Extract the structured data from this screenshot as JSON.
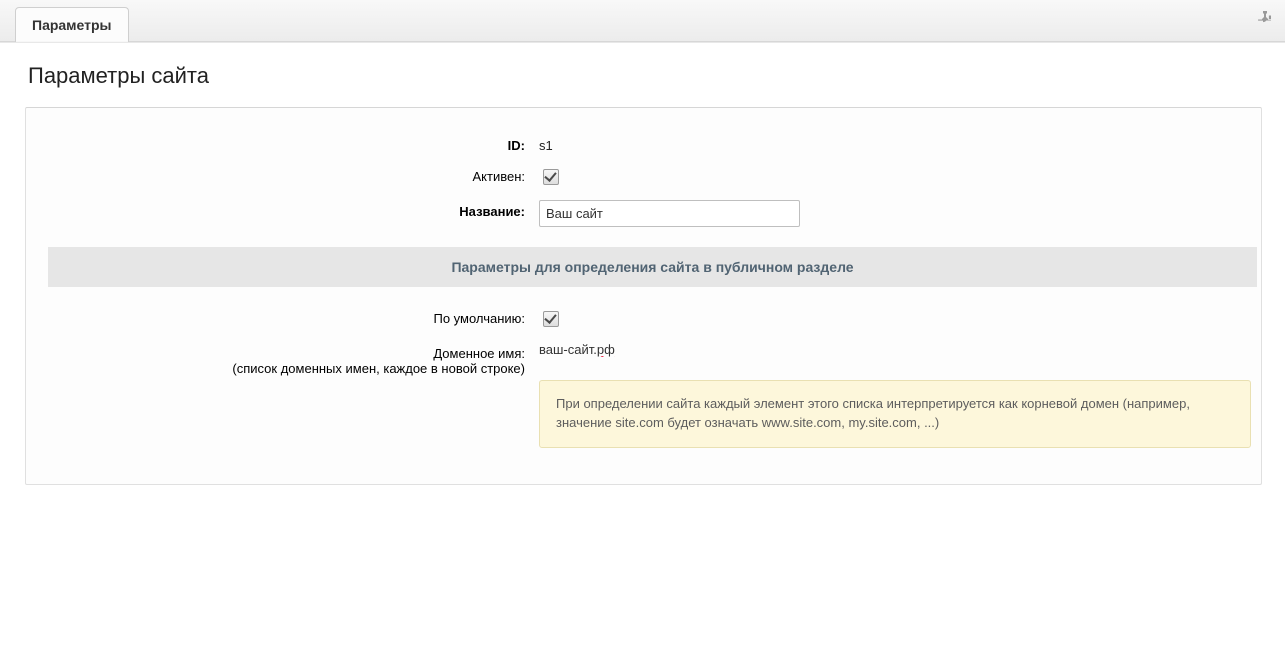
{
  "tab_label": "Параметры",
  "page_title": "Параметры сайта",
  "labels": {
    "id": "ID:",
    "active": "Активен:",
    "name": "Название:",
    "default": "По умолчанию:",
    "domain_name": "Доменное имя:",
    "domain_sub": "(список доменных имен, каждое в новой строке)"
  },
  "values": {
    "id": "s1",
    "active_checked": true,
    "name": "Ваш сайт",
    "default_checked": true,
    "domain_plain": "ваш-сайт.",
    "domain_err": "рф"
  },
  "section_heading": "Параметры для определения сайта в публичном разделе",
  "hint": "При определении сайта каждый элемент этого списка интерпретируется как корневой домен (например, значение site.com будет означать www.site.com, my.site.com, ...)"
}
